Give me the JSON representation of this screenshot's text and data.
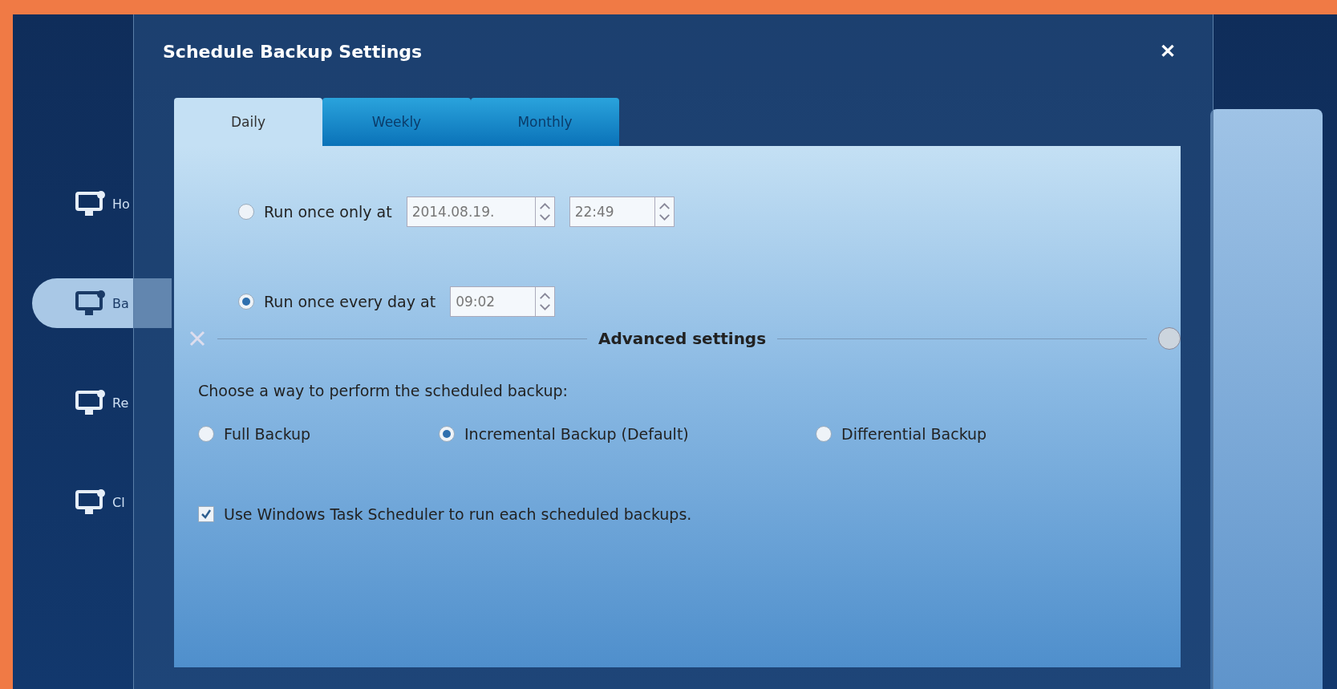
{
  "sidebar": {
    "items": [
      {
        "label": "Ho",
        "selected": false
      },
      {
        "label": "Ba",
        "selected": true
      },
      {
        "label": "Re",
        "selected": false
      },
      {
        "label": "Cl",
        "selected": false
      }
    ]
  },
  "dialog": {
    "title": "Schedule Backup Settings",
    "close": "✕",
    "tabs": [
      {
        "label": "Daily",
        "selected": true
      },
      {
        "label": "Weekly",
        "selected": false
      },
      {
        "label": "Monthly",
        "selected": false
      }
    ],
    "schedule": [
      {
        "label": "Run once only at",
        "selected": false,
        "fields": [
          "2014.08.19.",
          "22:49"
        ]
      },
      {
        "label": "Run once every day at",
        "selected": true,
        "fields": [
          "09:02"
        ]
      }
    ],
    "advanced": {
      "title": "Advanced settings",
      "prompt": "Choose a way to perform the scheduled backup:",
      "modes": [
        {
          "label": "Full Backup",
          "selected": false
        },
        {
          "label": "Incremental Backup (Default)",
          "selected": true
        },
        {
          "label": "Differential Backup",
          "selected": false
        }
      ],
      "task_scheduler": {
        "label": "Use Windows Task Scheduler to run each scheduled backups.",
        "checked": true
      }
    }
  }
}
